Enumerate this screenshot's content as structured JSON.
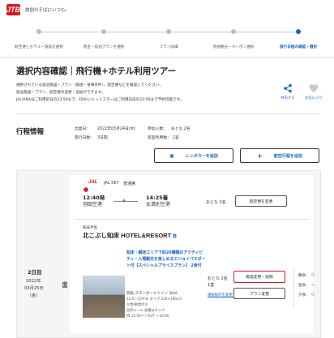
{
  "header": {
    "logo_text": "JTB",
    "tagline": "旅創のそばにいつも。"
  },
  "steps": [
    {
      "label": "航空便とホテル・旅館を選択",
      "active": false
    },
    {
      "label": "客室・宿泊プランを選択",
      "active": false
    },
    {
      "label": "プラン詳細",
      "active": false
    },
    {
      "label": "現地観光・クーポン選択",
      "active": false
    },
    {
      "label": "旅行日程の確認・選択",
      "active": true
    }
  ],
  "page": {
    "title": "選択内容確認｜飛行機+ホテル利用ツアー",
    "desc": [
      "選択されている宿泊施設・プラン（部屋・食事条件）、航空便などを確認してください。",
      "宿泊施設・プラン、航空便の変更・追加ができます。",
      "JAL/ANAはご利用前日の23:59まで、FDA/ジェットスターはご利用日前の23:59まで予約可能です。"
    ],
    "share_label": "共有する",
    "fav_label": "お気に入り"
  },
  "itinerary": {
    "title": "行程情報",
    "departure_label": "出発日：",
    "departure_value": "2022年03月24日(木)",
    "days_label": "旅行日数：",
    "days_value": "3日間",
    "participants_label": "参加人数：",
    "participants_value": "おとな 2名",
    "rooms_label": "客室利用数：",
    "rooms_value": "1室",
    "rental_btn": "レンタカーを追加",
    "flight_add_btn": "航空行程を追加"
  },
  "flight": {
    "airline": "JAL",
    "flight_no": "JAL 567",
    "class": "普通席",
    "dep_time": "12:40発",
    "dep_airport": "羽田空港",
    "arr_time": "14:25着",
    "arr_airport": "女満別空港",
    "pax": "おとな 2名",
    "change_btn": "航空便を変更"
  },
  "day": {
    "label": "2日目",
    "date_year": "2022年",
    "date_md": "03月25日",
    "weekday": "(金)"
  },
  "hotel": {
    "area": "知床半島",
    "name": "北こぶし知床 HOTEL&RESORT",
    "plan_title": "知床・網走エリアで約20種類のアクティビティ・入場観光を楽しめるエジョイパスポート付【スペシャルプライスプラン】 2食付",
    "room_type": "別館 スタンダードツイン 30㎡",
    "room_detail1": "12.5～23平米 タイプ 220×190cm",
    "meal": "夕食/朝食付き",
    "bath": "世界ルーム 設備はエリア",
    "checkin": "IN 15:00～ / OUT ～10:00",
    "pax": "おとな 2名",
    "rooms": "1室",
    "room_change_btn": "施設変更・削除",
    "plan_change_btn": "プラン変更",
    "facility_link": "選択館内を変更する",
    "meal_breakfast": "朝食：",
    "meal_lunch": "昼食：",
    "meal_dinner": "夕食：",
    "meal_mark": "○",
    "meal_mark_lunch": "ー",
    "meal_mark_dinner": "○"
  },
  "colors": {
    "brand_red": "#d71920",
    "accent_blue": "#1a63c6"
  }
}
